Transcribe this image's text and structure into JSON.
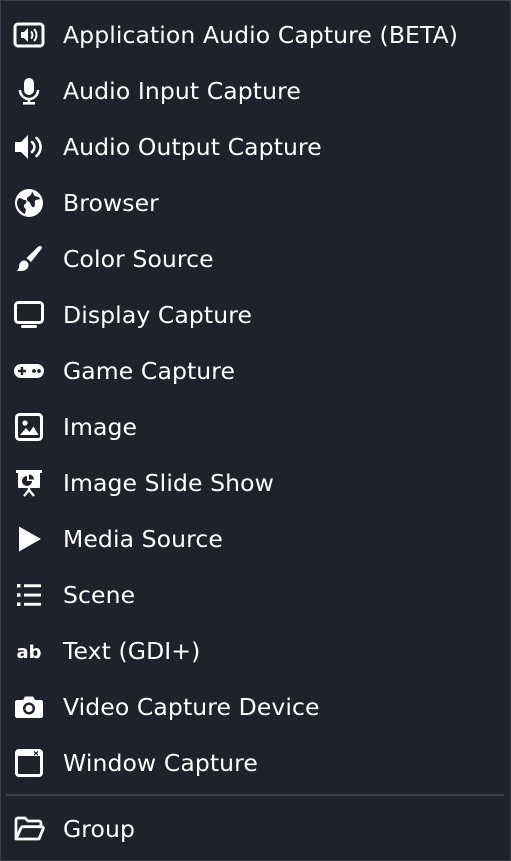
{
  "menu": {
    "items": [
      {
        "label": "Application Audio Capture (BETA)",
        "icon": "application-audio-icon"
      },
      {
        "label": "Audio Input Capture",
        "icon": "microphone-icon"
      },
      {
        "label": "Audio Output Capture",
        "icon": "speaker-icon"
      },
      {
        "label": "Browser",
        "icon": "globe-icon"
      },
      {
        "label": "Color Source",
        "icon": "paintbrush-icon"
      },
      {
        "label": "Display Capture",
        "icon": "monitor-icon"
      },
      {
        "label": "Game Capture",
        "icon": "gamepad-icon"
      },
      {
        "label": "Image",
        "icon": "image-icon"
      },
      {
        "label": "Image Slide Show",
        "icon": "slideshow-icon"
      },
      {
        "label": "Media Source",
        "icon": "play-icon"
      },
      {
        "label": "Scene",
        "icon": "list-icon"
      },
      {
        "label": "Text (GDI+)",
        "icon": "text-icon"
      },
      {
        "label": "Video Capture Device",
        "icon": "camera-icon"
      },
      {
        "label": "Window Capture",
        "icon": "window-icon"
      }
    ],
    "group_item": {
      "label": "Group",
      "icon": "folder-open-icon"
    }
  },
  "colors": {
    "background": "#1f222a",
    "text": "#ffffff",
    "separator": "#3b3f49"
  }
}
